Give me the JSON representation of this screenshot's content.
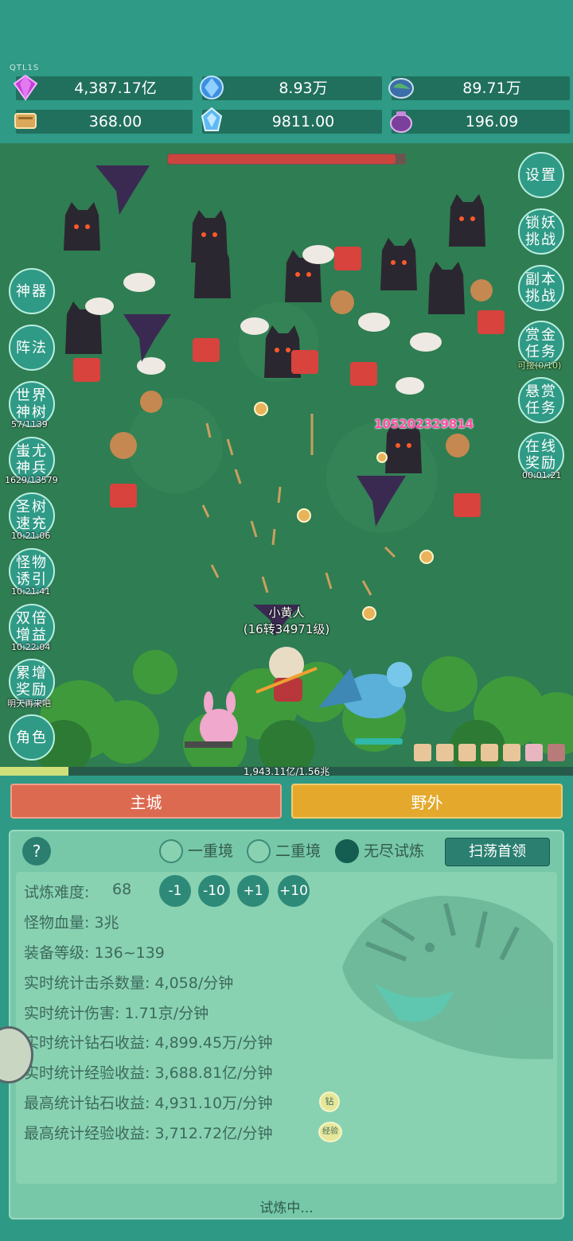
{
  "header": {
    "tag": "QTL1S",
    "resources": [
      {
        "icon": "purple-gem-icon",
        "value": "4,387.17亿"
      },
      {
        "icon": "blue-crystal-icon",
        "value": "8.93万"
      },
      {
        "icon": "earth-stone-icon",
        "value": "89.71万"
      },
      {
        "icon": "scroll-book-icon",
        "value": "368.00"
      },
      {
        "icon": "ice-crystal-icon",
        "value": "9811.00"
      },
      {
        "icon": "purple-pot-icon",
        "value": "196.09"
      }
    ]
  },
  "boss_hp_percent": 96,
  "left_menu": [
    {
      "label": "神器",
      "sub": ""
    },
    {
      "label": "阵法",
      "sub": ""
    },
    {
      "label": "世界神树",
      "sub": "57/1139"
    },
    {
      "label": "蚩尤神兵",
      "sub": "1629/13579"
    },
    {
      "label": "圣树速充",
      "sub": "10:21:06"
    },
    {
      "label": "怪物诱引",
      "sub": "10:21:41"
    },
    {
      "label": "双倍增益",
      "sub": "10:22:04"
    },
    {
      "label": "累增奖励",
      "sub": "明天再来吧"
    },
    {
      "label": "角色",
      "sub": ""
    }
  ],
  "right_menu": [
    {
      "label": "设置",
      "sub": ""
    },
    {
      "label": "锁妖挑战",
      "sub": ""
    },
    {
      "label": "副本挑战",
      "sub": ""
    },
    {
      "label": "赏金任务",
      "sub": "可接(0/10)"
    },
    {
      "label": "悬赏任务",
      "sub": ""
    },
    {
      "label": "在线奖励",
      "sub": "00:01:21"
    }
  ],
  "battle": {
    "damage_number": "105202329814",
    "hero_name": "小黄人",
    "hero_level": "(16转34971级)"
  },
  "exp": {
    "text": "1,943.11亿/1.56兆",
    "percent": 12
  },
  "tabs": {
    "main_city": "主城",
    "wild": "野外"
  },
  "trial": {
    "help": "?",
    "modes": [
      "一重境",
      "二重境",
      "无尽试炼"
    ],
    "selected_mode": "无尽试炼",
    "sweep_button": "扫荡首领",
    "difficulty_label": "试炼难度:",
    "difficulty_value": "68",
    "steps": [
      "-1",
      "-10",
      "+1",
      "+10"
    ],
    "stats": [
      "怪物血量:  3兆",
      "装备等级:  136~139",
      "实时统计击杀数量:  4,058/分钟",
      "实时统计伤害:  1.71京/分钟",
      "实时统计钻石收益:  4,899.45万/分钟",
      "实时统计经验收益:  3,688.81亿/分钟",
      "最高统计钻石收益:  4,931.10万/分钟",
      "最高统计经验收益:  3,712.72亿/分钟"
    ],
    "badge_diamond": "钻",
    "badge_exp": "经验",
    "status": "试炼中..."
  }
}
